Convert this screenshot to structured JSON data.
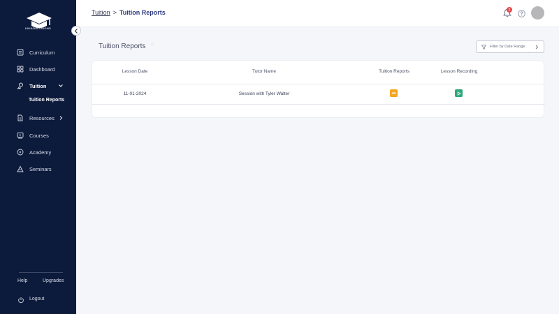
{
  "sidebar": {
    "logo_text": "UNIADMISSIONS",
    "nav": {
      "curriculum": "Curriculum",
      "dashboard": "Dashboard",
      "tuition": "Tuition",
      "tuition_reports": "Tuition Reports",
      "resources": "Resources",
      "courses": "Courses",
      "academy": "Academy",
      "seminars": "Seminars"
    },
    "help": "Help",
    "upgrades": "Upgrades",
    "logout": "Logout"
  },
  "header": {
    "breadcrumb_parent": "Tuition",
    "breadcrumb_separator": ">",
    "breadcrumb_current": "Tuition Reports",
    "notification_count": "1"
  },
  "main": {
    "title": "Tuition Reports",
    "filter_label": "Filter by Date Range",
    "table": {
      "headers": {
        "lesson_date": "Lesson Date",
        "tutor_name": "Tutor Name",
        "tuition_reports": "Tuition Reports",
        "lesson_recording": "Lesson Recording"
      },
      "rows": [
        {
          "lesson_date": "11-01-2024",
          "tutor_name": "Session with Tyler Walter"
        }
      ]
    }
  },
  "colors": {
    "sidebar_bg": "#0c1a3b",
    "accent": "#2e3a80",
    "report_button": "#f5a623",
    "recording_button": "#2ea77c",
    "badge": "#e5484d"
  }
}
